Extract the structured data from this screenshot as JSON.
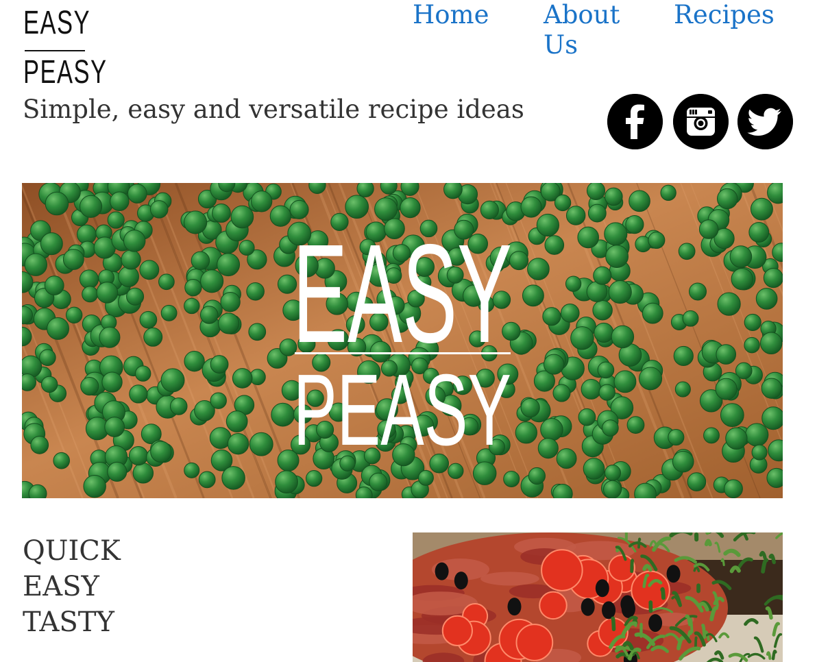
{
  "logo": {
    "line1": "EASY",
    "line2": "PEASY"
  },
  "nav": {
    "home": "Home",
    "about": "About Us",
    "recipes": "Recipes"
  },
  "tagline": "Simple, easy and versatile recipe ideas",
  "social": [
    {
      "name": "facebook-icon"
    },
    {
      "name": "instagram-icon"
    },
    {
      "name": "twitter-icon"
    }
  ],
  "hero": {
    "line1": "EASY",
    "line2": "PEASY"
  },
  "slogan": {
    "line1": "QUICK",
    "line2": "EASY",
    "line3": "TASTY"
  },
  "colors": {
    "link": "#1a73c8",
    "text": "#333333",
    "pea": "#2e8b3a",
    "wood": "#b5723f"
  }
}
